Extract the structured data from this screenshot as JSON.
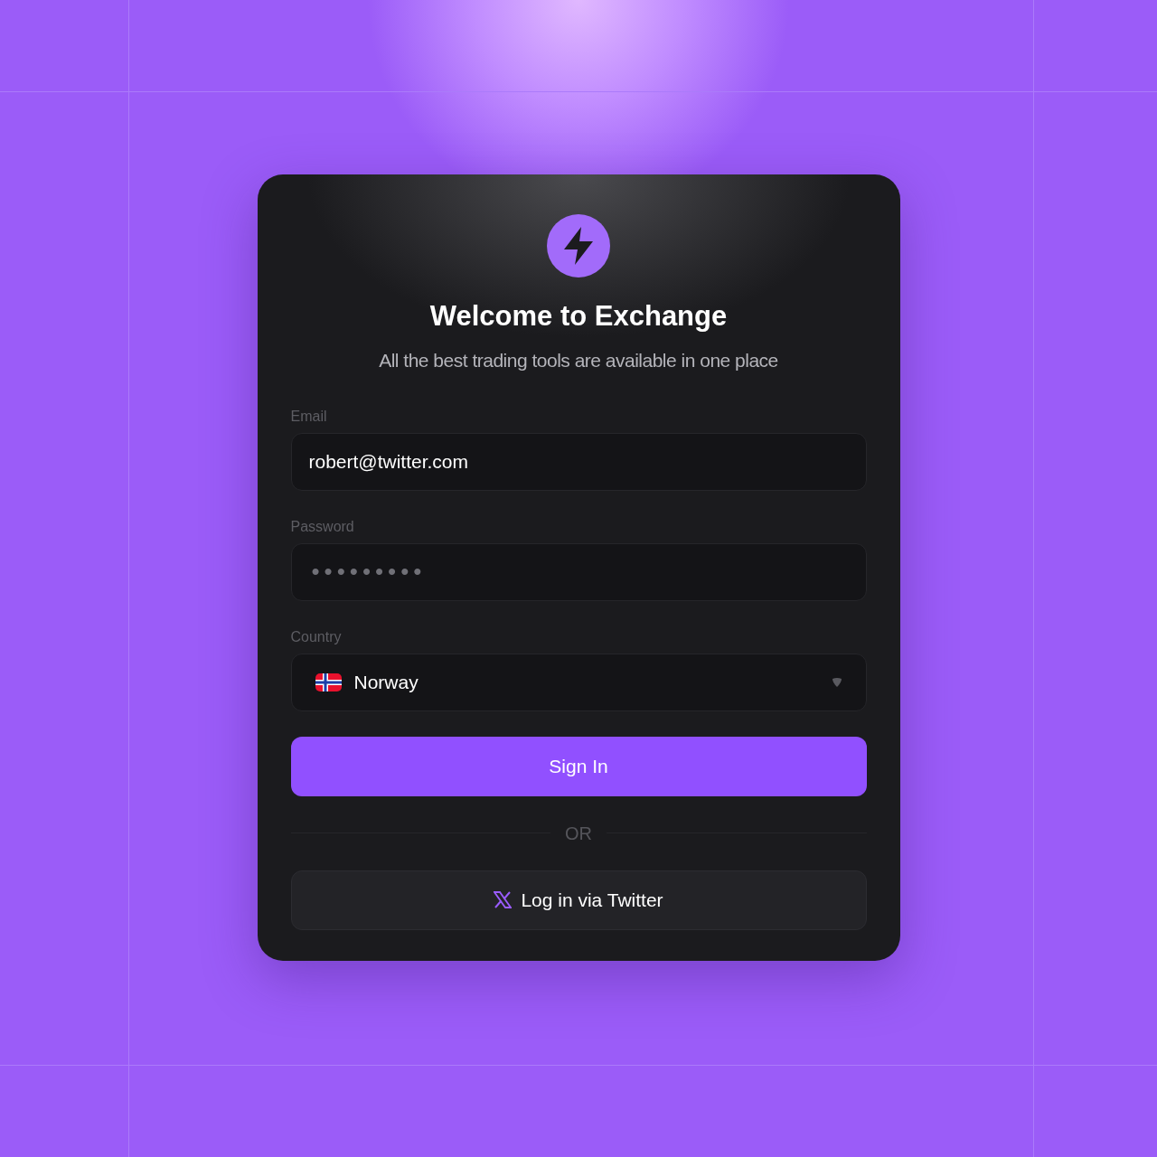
{
  "header": {
    "title": "Welcome to Exchange",
    "subtitle": "All the best trading tools are available in one place"
  },
  "fields": [
    {
      "kind": "text",
      "label": "Email",
      "value": "robert@twitter.com"
    },
    {
      "kind": "password",
      "label": "Password",
      "value": "•••••••••"
    },
    {
      "kind": "select",
      "label": "Country",
      "value": "Norway"
    }
  ],
  "primary_button": "Sign In",
  "divider": "OR",
  "social_button": "Log in via Twitter"
}
